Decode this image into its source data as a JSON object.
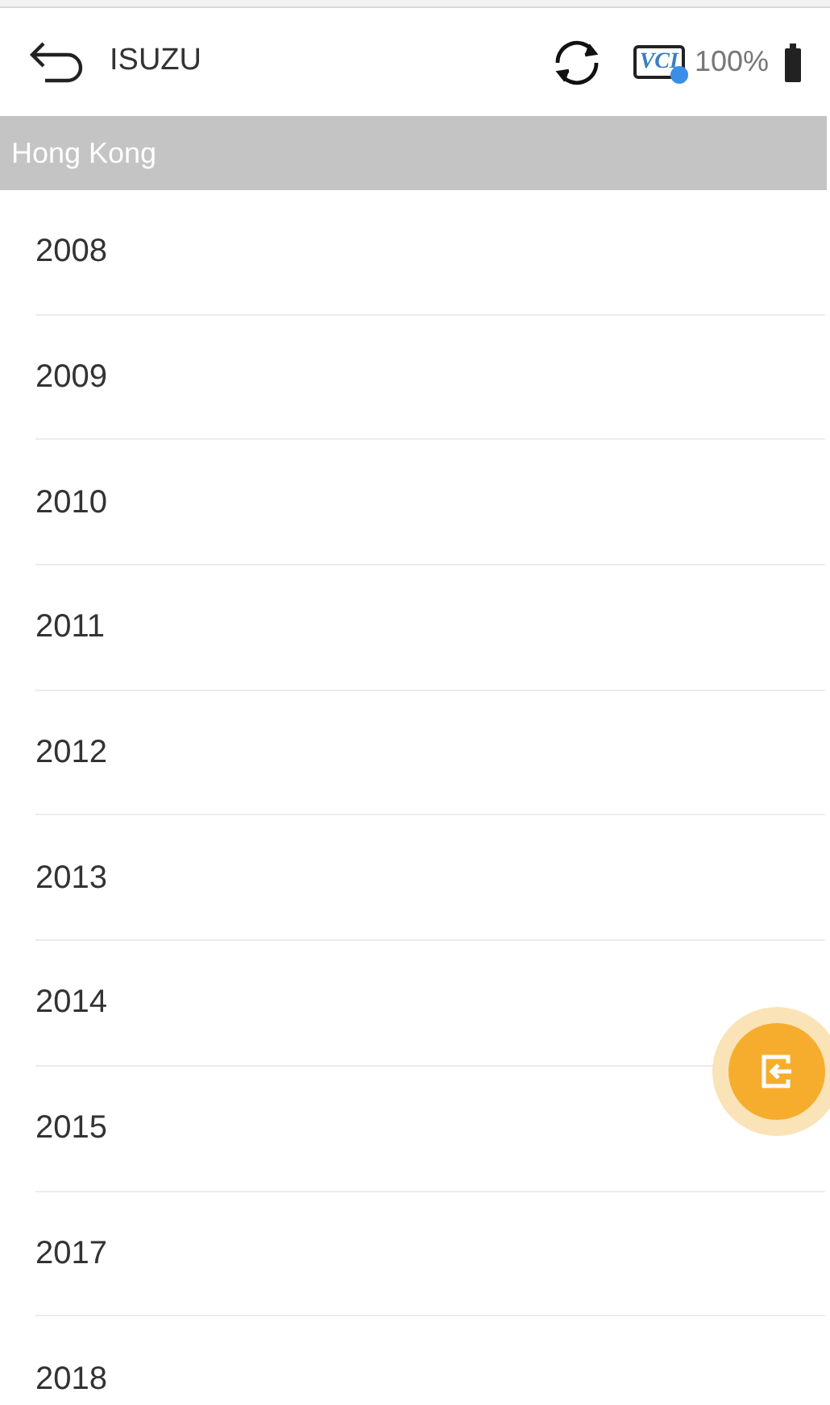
{
  "header": {
    "title": "ISUZU",
    "vci_label": "VCI",
    "battery": "100%"
  },
  "section": {
    "title": "Hong Kong"
  },
  "years": [
    "2008",
    "2009",
    "2010",
    "2011",
    "2012",
    "2013",
    "2014",
    "2015",
    "2017",
    "2018"
  ]
}
